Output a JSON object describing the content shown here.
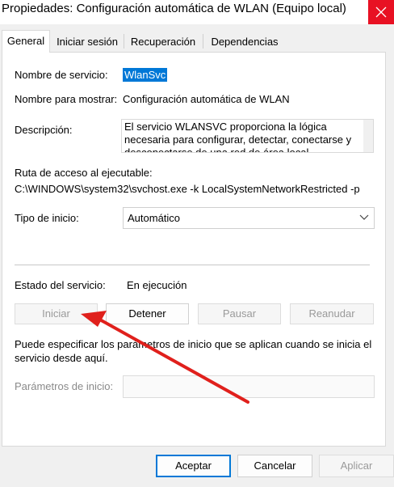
{
  "window": {
    "title": "Propiedades: Configuración automática de WLAN (Equipo local)"
  },
  "tabs": [
    {
      "label": "General",
      "active": true
    },
    {
      "label": "Iniciar sesión",
      "active": false
    },
    {
      "label": "Recuperación",
      "active": false
    },
    {
      "label": "Dependencias",
      "active": false
    }
  ],
  "general": {
    "service_name_label": "Nombre de servicio:",
    "service_name_value": "WlanSvc",
    "display_name_label": "Nombre para mostrar:",
    "display_name_value": "Configuración automática de WLAN",
    "description_label": "Descripción:",
    "description_value": "El servicio WLANSVC proporciona la lógica necesaria para configurar, detectar, conectarse y desconectarse de una red de área local",
    "path_label": "Ruta de acceso al ejecutable:",
    "path_value": "C:\\WINDOWS\\system32\\svchost.exe -k LocalSystemNetworkRestricted -p",
    "startup_type_label": "Tipo de inicio:",
    "startup_type_value": "Automático",
    "status_label": "Estado del servicio:",
    "status_value": "En ejecución",
    "buttons": {
      "start": "Iniciar",
      "stop": "Detener",
      "pause": "Pausar",
      "resume": "Reanudar"
    },
    "params_hint": "Puede especificar los parámetros de inicio que se aplican cuando se inicia el servicio desde aquí.",
    "params_label": "Parámetros de inicio:",
    "params_value": ""
  },
  "footer": {
    "ok": "Aceptar",
    "cancel": "Cancelar",
    "apply": "Aplicar"
  },
  "colors": {
    "selection": "#0078d7",
    "close_button": "#e81123",
    "annotation_arrow": "#e0201c"
  },
  "icons": {
    "close": "close-icon",
    "dropdown": "chevron-down-icon"
  }
}
